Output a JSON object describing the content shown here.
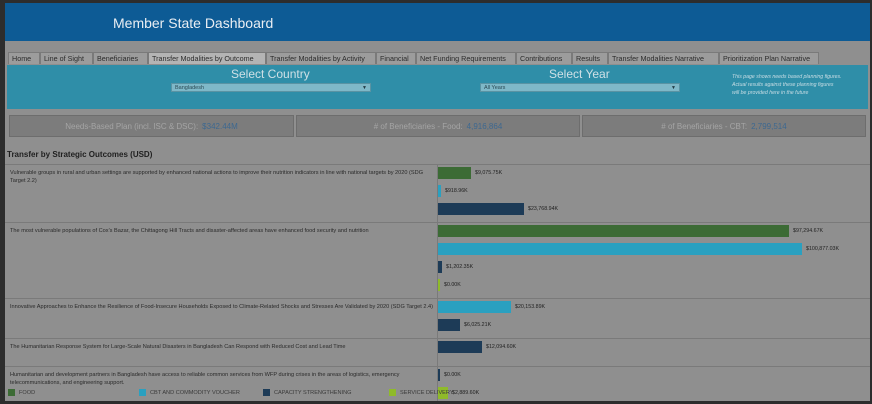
{
  "header": {
    "title": "Member State Dashboard"
  },
  "tabs": [
    "Home",
    "Line of Sight",
    "Beneficiaries",
    "Transfer Modalities by Outcome",
    "Transfer Modalities by Activity",
    "Financial",
    "Net Funding Requirements",
    "Contributions",
    "Results",
    "Transfer Modalities Narrative",
    "Prioritization Plan Narrative"
  ],
  "active_tab": "Transfer Modalities by Outcome",
  "filters": {
    "country_label": "Select Country",
    "country_value": "Bangladesh",
    "year_label": "Select Year",
    "year_value": "All Years",
    "note_line1": "This page shows needs based planning figures.",
    "note_line2": "Actual results against these planning figures",
    "note_line3": "will be provided here in the future"
  },
  "kpis": {
    "nbp_label": "Needs-Based Plan (incl. ISC & DSC):",
    "nbp_value": "$342.44M",
    "food_label": "# of Beneficiaries - Food:",
    "food_value": "4,916,864",
    "cbt_label": "# of Beneficiaries -  CBT:",
    "cbt_value": "2,799,514"
  },
  "section_title": "Transfer by Strategic Outcomes (USD)",
  "colors": {
    "food": "#3c6b35",
    "cbt": "#2aa0c0",
    "capacity": "#1d3b57",
    "service": "#8fba2a"
  },
  "chart_data": {
    "type": "bar",
    "orientation": "horizontal",
    "outcomes": [
      {
        "text": "Vulnerable groups in rural and urban settings are supported by enhanced national actions to improve their nutrition indicators in line with national targets by 2020 (SDG Target 2.2)",
        "bars": [
          {
            "modality": "food",
            "value": 9075.75,
            "label": "$9,075.75K"
          },
          {
            "modality": "cbt",
            "value": 918.96,
            "label": "$918.96K"
          },
          {
            "modality": "capacity",
            "value": 23768.94,
            "label": "$23,768.94K"
          }
        ]
      },
      {
        "text": "The most vulnerable populations of Cox's Bazar, the Chittagong Hill Tracts and disaster-affected areas have enhanced food security and nutrition",
        "bars": [
          {
            "modality": "food",
            "value": 97294.67,
            "label": "$97,294.67K"
          },
          {
            "modality": "cbt",
            "value": 100877.03,
            "label": "$100,877.03K"
          },
          {
            "modality": "capacity",
            "value": 1202.35,
            "label": "$1,202.35K"
          },
          {
            "modality": "service",
            "value": 0,
            "label": "$0.00K"
          }
        ]
      },
      {
        "text": "Innovative Approaches to Enhance the Resilience of Food-Insecure Households Exposed to Climate-Related Shocks and Stresses Are Validated by 2020 (SDG Target 2.4)",
        "bars": [
          {
            "modality": "cbt",
            "value": 20153.89,
            "label": "$20,153.89K"
          },
          {
            "modality": "capacity",
            "value": 6025.21,
            "label": "$6,025.21K"
          }
        ]
      },
      {
        "text": "The Humanitarian Response System for Large-Scale Natural Disasters in Bangladesh Can Respond with Reduced Cost and Lead Time",
        "bars": [
          {
            "modality": "capacity",
            "value": 12094.6,
            "label": "$12,094.60K"
          }
        ]
      },
      {
        "text": "Humanitarian and development partners in Bangladesh have access to reliable common services from WFP during crises in the areas of logistics, emergency telecommunications, and engineering support.",
        "bars": [
          {
            "modality": "capacity",
            "value": 0,
            "label": "$0.00K"
          },
          {
            "modality": "service",
            "value": 2889.6,
            "label": "$2,889.60K"
          }
        ]
      }
    ],
    "legend": [
      {
        "modality": "food",
        "label": "FOOD"
      },
      {
        "modality": "cbt",
        "label": "CBT AND COMMODITY VOUCHER"
      },
      {
        "modality": "capacity",
        "label": "CAPACITY STRENGTHENING"
      },
      {
        "modality": "service",
        "label": "SERVICE DELIVERY"
      }
    ]
  }
}
